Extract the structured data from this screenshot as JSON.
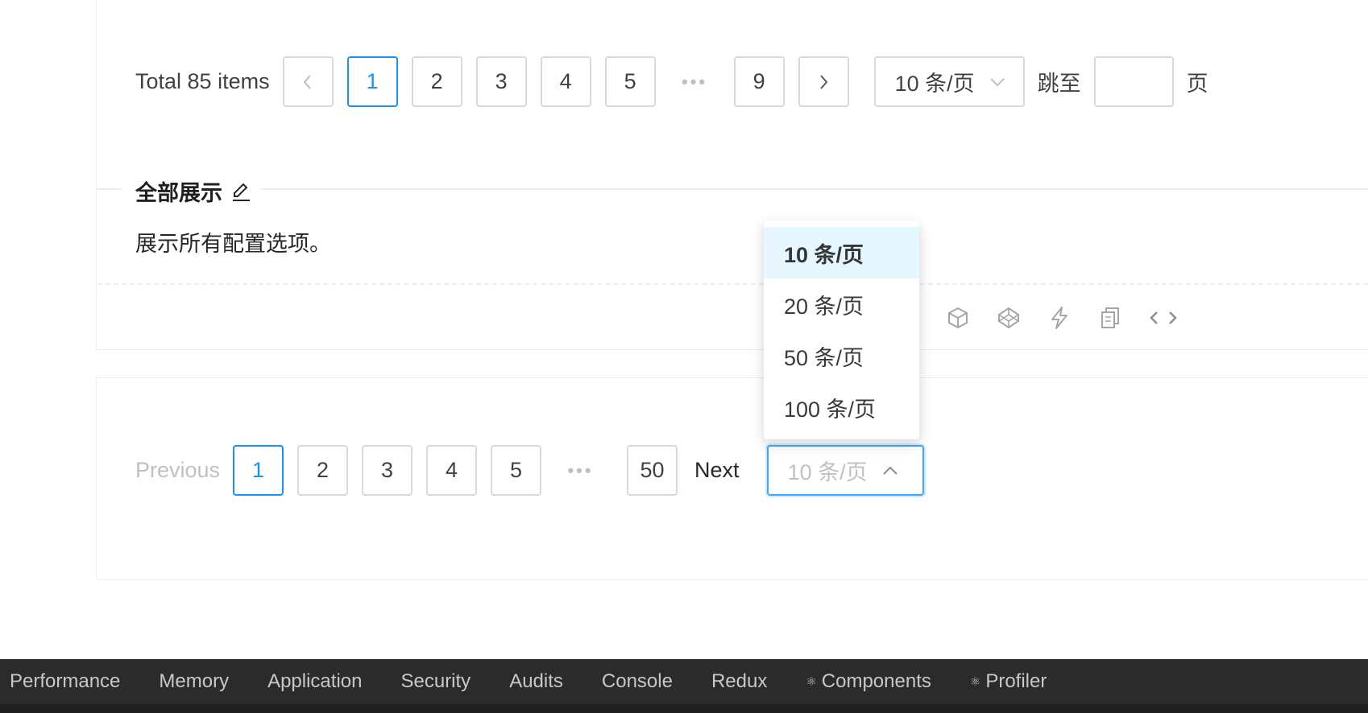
{
  "pagination_top": {
    "total_text": "Total 85 items",
    "pages": [
      "1",
      "2",
      "3",
      "4",
      "5"
    ],
    "last_page": "9",
    "active_page": "1",
    "ellipsis": "•••",
    "page_size": "10 条/页",
    "jumper_label": "跳至",
    "jumper_suffix": "页",
    "jumper_value": ""
  },
  "section": {
    "title": "全部展示",
    "description": "展示所有配置选项。",
    "action_icons": [
      "codesandbox-icon",
      "codepen-icon",
      "stackblitz-icon",
      "copy-icon",
      "code-expand-icon"
    ]
  },
  "pagination_bottom": {
    "prev_label": "Previous",
    "next_label": "Next",
    "pages": [
      "1",
      "2",
      "3",
      "4",
      "5"
    ],
    "last_page": "50",
    "active_page": "1",
    "ellipsis": "•••",
    "page_size": "10 条/页"
  },
  "page_size_dropdown": {
    "options": [
      "10 条/页",
      "20 条/页",
      "50 条/页",
      "100 条/页"
    ],
    "selected": "10 条/页"
  },
  "devtools": {
    "tabs": [
      "Performance",
      "Memory",
      "Application",
      "Security",
      "Audits",
      "Console",
      "Redux",
      "Components",
      "Profiler"
    ],
    "react_icon": "⚛"
  },
  "colors": {
    "primary": "#1890ff",
    "border": "#d9d9d9",
    "selected_option_bg": "#e6f7ff",
    "devtools_bg": "#2b2b2b"
  }
}
